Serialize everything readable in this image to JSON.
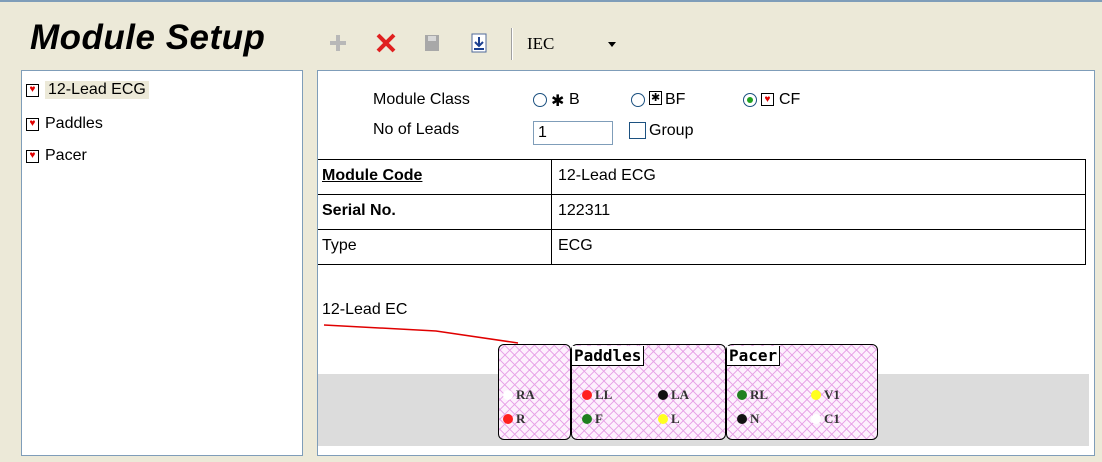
{
  "header": {
    "title": "Module Setup",
    "standard": "IEC"
  },
  "toolbar": {
    "icons": [
      "add-icon",
      "delete-icon",
      "save-icon",
      "import-icon"
    ]
  },
  "tree": {
    "items": [
      {
        "label": "12-Lead ECG",
        "selected": true
      },
      {
        "label": "Paddles",
        "selected": false
      },
      {
        "label": "Pacer",
        "selected": false
      }
    ]
  },
  "panel": {
    "module_class_label": "Module Class",
    "class_options": [
      {
        "label": "B",
        "checked": false
      },
      {
        "label": "BF",
        "checked": false
      },
      {
        "label": "CF",
        "checked": true
      }
    ],
    "leads_label": "No of Leads",
    "leads_value": "1",
    "group_label": "Group",
    "group_checked": false
  },
  "grid": {
    "rows": [
      {
        "key": "Module Code",
        "value": "12-Lead ECG"
      },
      {
        "key": "Serial No.",
        "value": "122311"
      },
      {
        "key": "Type",
        "value": "ECG"
      }
    ]
  },
  "diagram": {
    "label": "12-Lead EC",
    "connectors": [
      {
        "name": "",
        "pins": [
          {
            "label": "RA",
            "color": "#ffffff"
          },
          {
            "label": "R",
            "color": "#ff2020"
          }
        ]
      },
      {
        "name": "Paddles",
        "pins": [
          {
            "label": "LL",
            "color": "#ff2020"
          },
          {
            "label": "LA",
            "color": "#111111"
          },
          {
            "label": "F",
            "color": "#208020"
          },
          {
            "label": "L",
            "color": "#ffff20"
          }
        ]
      },
      {
        "name": "Pacer",
        "pins": [
          {
            "label": "RL",
            "color": "#208020"
          },
          {
            "label": "V1",
            "color": "#ffff20"
          },
          {
            "label": "N",
            "color": "#111111"
          },
          {
            "label": "C1",
            "color": "#ffffff"
          }
        ]
      }
    ]
  },
  "colors": {
    "background": "#ece9d8",
    "border": "#7f9db9",
    "delete": "#e02020",
    "heart": "#e00000",
    "radio_checked": "#21a121"
  }
}
